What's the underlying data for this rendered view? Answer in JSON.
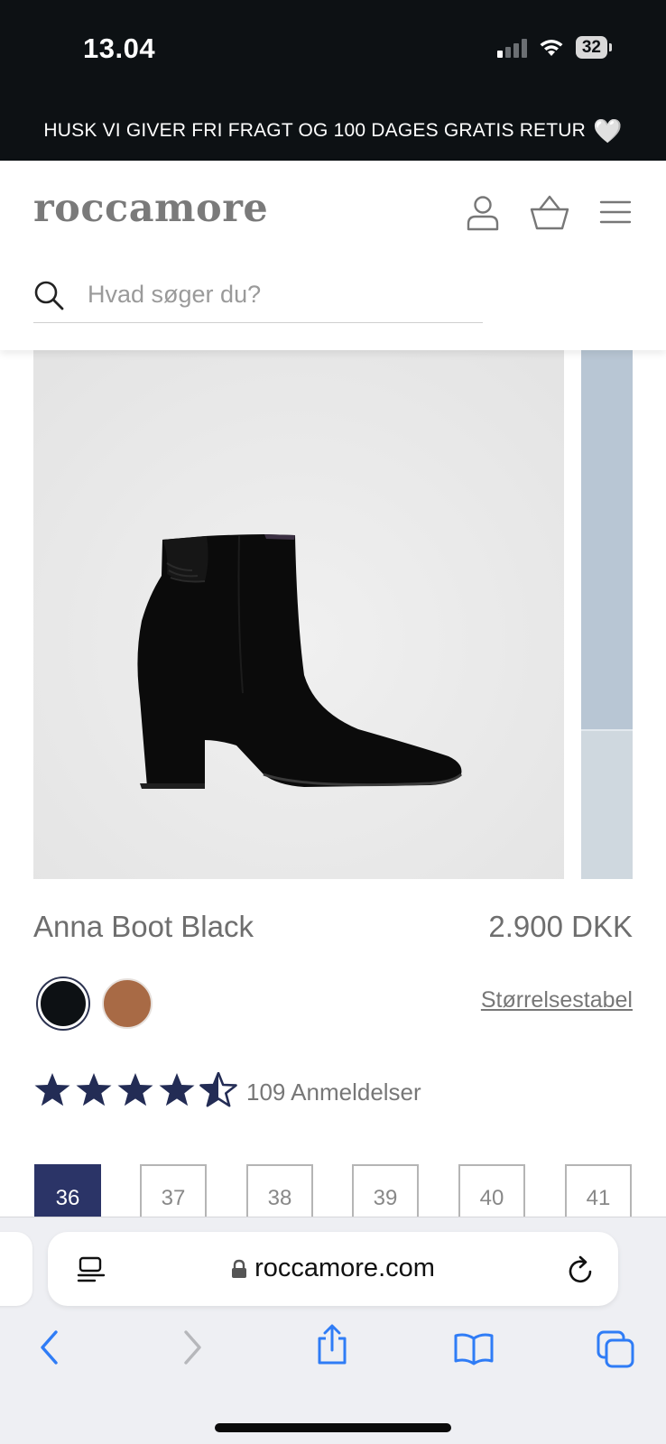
{
  "status_bar": {
    "time": "13.04",
    "battery": "32"
  },
  "announcement": {
    "text": "HUSK VI GIVER FRI FRAGT OG 100 DAGES GRATIS RETUR",
    "emoji": "🤍"
  },
  "header": {
    "logo": "roccamore"
  },
  "search": {
    "placeholder": "Hvad søger du?"
  },
  "product": {
    "name": "Anna Boot Black",
    "price": "2.900 DKK",
    "colors": [
      "#0d1114",
      "#a86a45"
    ],
    "selected_color": "black",
    "size_chart_label": "Størrelsestabel",
    "rating": 4.5,
    "reviews_label": "109 Anmeldelser",
    "sizes": [
      "36",
      "37",
      "38",
      "39",
      "40",
      "41"
    ],
    "selected_size": "36"
  },
  "browser": {
    "url": "roccamore.com"
  },
  "colors": {
    "brand_navy": "#2b3467",
    "dark_bar": "#0d1114",
    "star": "#232c55"
  }
}
